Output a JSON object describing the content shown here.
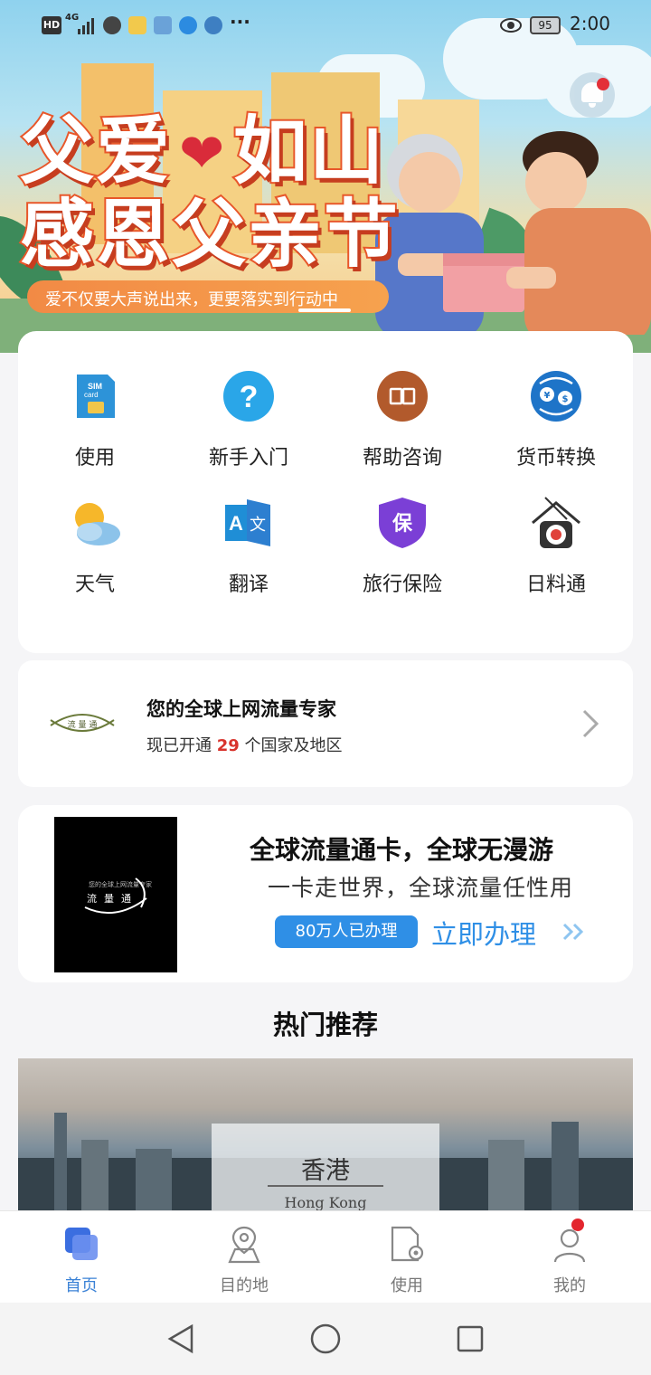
{
  "status_bar": {
    "network": "4G",
    "battery": "95",
    "time": "2:00",
    "icons": [
      "hd-icon",
      "signal-icon",
      "wechat-icon",
      "app-icon-cup",
      "app-icon-chart",
      "app-icon-circle",
      "app-icon-link",
      "more-dots-icon",
      "eye-icon",
      "battery-icon"
    ]
  },
  "banner": {
    "title_line1_a": "父爱",
    "title_line1_b": "如山",
    "title_line2": "感恩父亲节",
    "subtitle": "爱不仅要大声说出来，更要落实到行动中"
  },
  "grid": [
    {
      "label": "使用",
      "icon": "sim-card-icon"
    },
    {
      "label": "新手入门",
      "icon": "question-icon"
    },
    {
      "label": "帮助咨询",
      "icon": "book-icon"
    },
    {
      "label": "货币转换",
      "icon": "currency-exchange-icon"
    },
    {
      "label": "天气",
      "icon": "weather-icon"
    },
    {
      "label": "翻译",
      "icon": "translate-icon"
    },
    {
      "label": "旅行保险",
      "icon": "insurance-shield-icon"
    },
    {
      "label": "日料通",
      "icon": "sushi-icon"
    }
  ],
  "promo": {
    "logo_text": "流 量 通",
    "title": "您的全球上网流量专家",
    "sub_prefix": "现已开通",
    "sub_number": "29",
    "sub_suffix": "个国家及地区"
  },
  "ad": {
    "img_tiny": "您的全球上网流量专家",
    "img_logo": "流量通",
    "title": "全球流量通卡，全球无漫游",
    "subtitle": "一卡走世界，全球流量任性用",
    "badge": "80万人已办理",
    "cta": "立即办理"
  },
  "hot": {
    "title": "热门推荐",
    "card_name": "香港",
    "card_en": "Hong Kong"
  },
  "tabs": [
    {
      "label": "首页",
      "icon": "home-icon",
      "active": true
    },
    {
      "label": "目的地",
      "icon": "map-pin-icon",
      "active": false
    },
    {
      "label": "使用",
      "icon": "document-gear-icon",
      "active": false
    },
    {
      "label": "我的",
      "icon": "profile-icon",
      "active": false
    }
  ],
  "colors": {
    "accent": "#3b82d6",
    "cta_blue": "#2f8fe6",
    "highlight_red": "#d8332c",
    "banner_orange": "#e8572a"
  }
}
